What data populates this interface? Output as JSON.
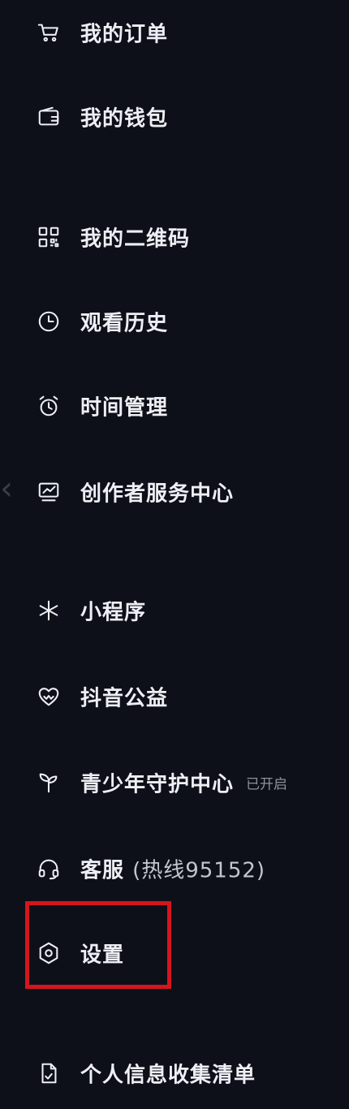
{
  "menu": {
    "orders": {
      "label": "我的订单",
      "icon": "cart-icon"
    },
    "wallet": {
      "label": "我的钱包",
      "icon": "wallet-icon"
    },
    "qrcode": {
      "label": "我的二维码",
      "icon": "qrcode-icon"
    },
    "history": {
      "label": "观看历史",
      "icon": "clock-icon"
    },
    "time_management": {
      "label": "时间管理",
      "icon": "alarm-clock-icon"
    },
    "creator_center": {
      "label": "创作者服务中心",
      "icon": "monitor-chart-icon"
    },
    "mini_programs": {
      "label": "小程序",
      "icon": "asterisk-icon"
    },
    "charity": {
      "label": "抖音公益",
      "icon": "heart-icon"
    },
    "youth_protection": {
      "label": "青少年守护中心",
      "badge": "已开启",
      "icon": "sprout-icon"
    },
    "customer_service": {
      "label": "客服",
      "suffix": "(热线95152)",
      "icon": "headset-icon"
    },
    "settings": {
      "label": "设置",
      "icon": "hexagon-gear-icon"
    },
    "personal_info": {
      "label": "个人信息收集清单",
      "icon": "document-icon"
    }
  },
  "highlight_color": "#d4161c"
}
